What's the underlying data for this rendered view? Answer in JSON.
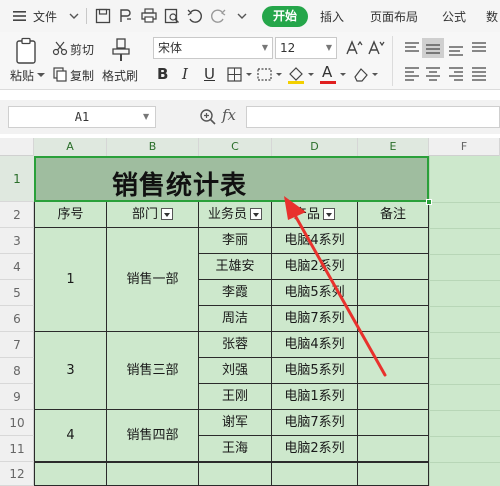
{
  "menubar": {
    "file_label": "文件",
    "tabs": [
      "开始",
      "插入",
      "页面布局",
      "公式",
      "数"
    ]
  },
  "ribbon": {
    "paste_label": "粘贴",
    "cut_label": "剪切",
    "copy_label": "复制",
    "format_painter_label": "格式刷",
    "font_name": "宋体",
    "font_size": "12",
    "bold": "B",
    "italic": "I",
    "underline": "U",
    "font_color_letter": "A"
  },
  "formula_bar": {
    "cell_ref": "A1",
    "fx_label": "fx",
    "content": ""
  },
  "sheet": {
    "columns": [
      "A",
      "B",
      "C",
      "D",
      "E",
      "F"
    ],
    "rows": [
      "1",
      "2",
      "3",
      "4",
      "5",
      "6",
      "7",
      "8",
      "9",
      "10",
      "11",
      "12"
    ],
    "title": "销售统计表",
    "headers": [
      "序号",
      "部门",
      "业务员",
      "产品",
      "备注"
    ],
    "groups": [
      {
        "no": "1",
        "dept": "销售一部"
      },
      {
        "no": "3",
        "dept": "销售三部"
      },
      {
        "no": "4",
        "dept": "销售四部"
      }
    ],
    "staff": [
      "李丽",
      "王雄安",
      "李霞",
      "周洁",
      "张蓉",
      "刘强",
      "王刚",
      "谢军",
      "王海"
    ],
    "products": [
      "电脑4系列",
      "电脑2系列",
      "电脑5系列",
      "电脑7系列",
      "电脑4系列",
      "电脑5系列",
      "电脑1系列",
      "电脑7系列",
      "电脑2系列"
    ]
  },
  "colors": {
    "accent": "#25a64a",
    "sheet_fill": "#cde8cc",
    "title_fill": "#9fbd9f",
    "arrow": "#e8322d"
  }
}
